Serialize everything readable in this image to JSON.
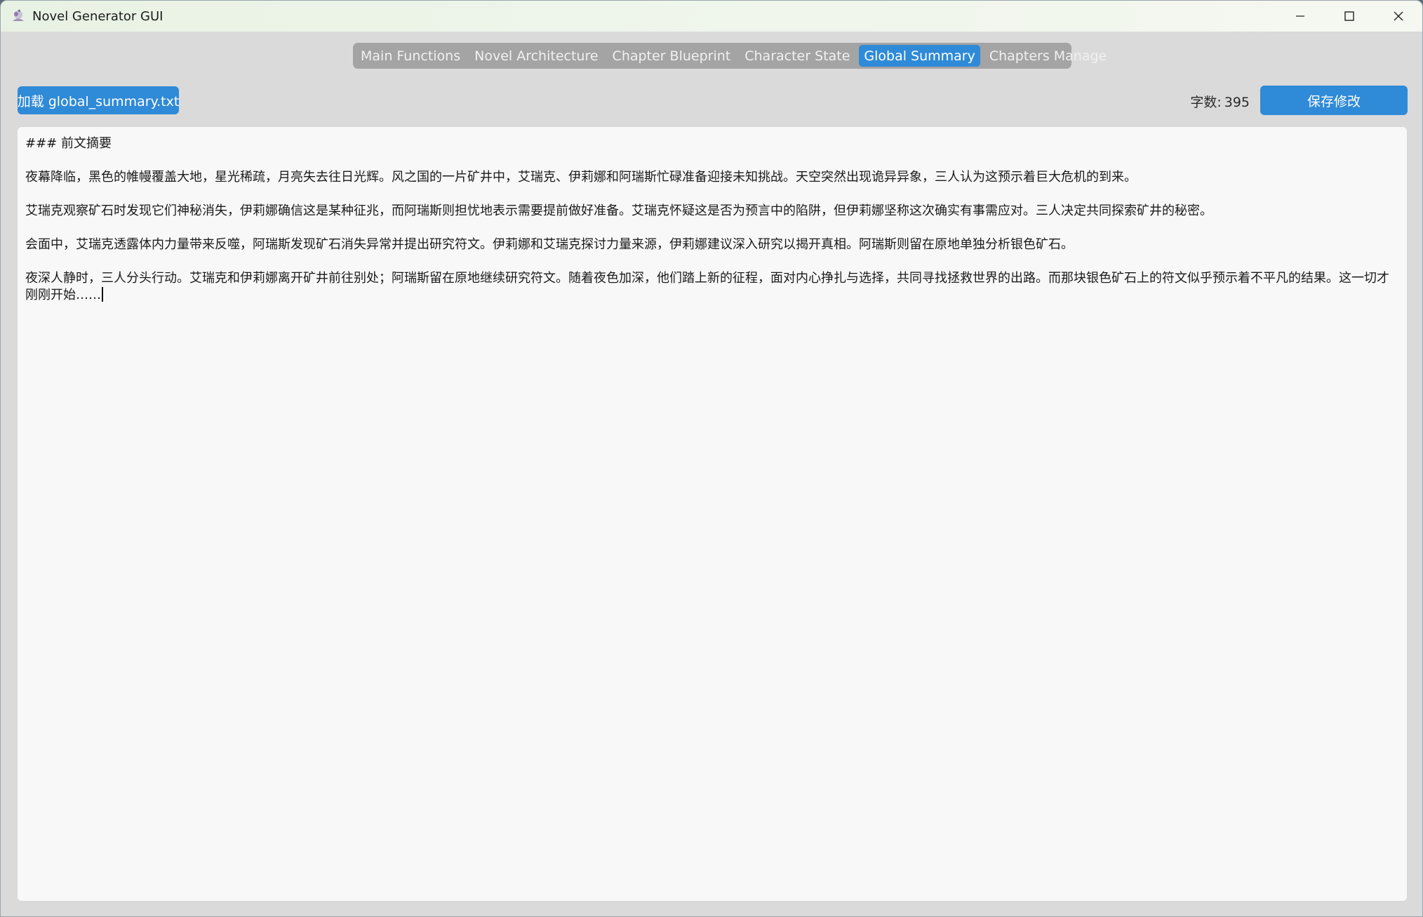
{
  "window": {
    "title": "Novel Generator GUI"
  },
  "tabs": [
    {
      "label": "Main Functions",
      "active": false
    },
    {
      "label": "Novel Architecture",
      "active": false
    },
    {
      "label": "Chapter Blueprint",
      "active": false
    },
    {
      "label": "Character State",
      "active": false
    },
    {
      "label": "Global Summary",
      "active": true
    },
    {
      "label": "Chapters Manage",
      "active": false
    }
  ],
  "toolbar": {
    "load_label": "加载 global_summary.txt",
    "wordcount_label": "字数:",
    "wordcount_value": "395",
    "save_label": "保存修改"
  },
  "editor": {
    "heading": "### 前文摘要",
    "paragraphs": [
      "夜幕降临，黑色的帷幔覆盖大地，星光稀疏，月亮失去往日光辉。风之国的一片矿井中，艾瑞克、伊莉娜和阿瑞斯忙碌准备迎接未知挑战。天空突然出现诡异异象，三人认为这预示着巨大危机的到来。",
      "艾瑞克观察矿石时发现它们神秘消失，伊莉娜确信这是某种征兆，而阿瑞斯则担忧地表示需要提前做好准备。艾瑞克怀疑这是否为预言中的陷阱，但伊莉娜坚称这次确实有事需应对。三人决定共同探索矿井的秘密。",
      "会面中，艾瑞克透露体内力量带来反噬，阿瑞斯发现矿石消失异常并提出研究符文。伊莉娜和艾瑞克探讨力量来源，伊莉娜建议深入研究以揭开真相。阿瑞斯则留在原地单独分析银色矿石。",
      "夜深人静时，三人分头行动。艾瑞克和伊莉娜离开矿井前往别处；阿瑞斯留在原地继续研究符文。随着夜色加深，他们踏上新的征程，面对内心挣扎与选择，共同寻找拯救世界的出路。而那块银色矿石上的符文似乎预示着不平凡的结果。这一切才刚刚开始……"
    ]
  },
  "colors": {
    "accent": "#2f8ad7",
    "tabbar_bg": "#a4a4a4",
    "window_bg": "#dadada",
    "editor_bg": "#f8f8f8"
  }
}
